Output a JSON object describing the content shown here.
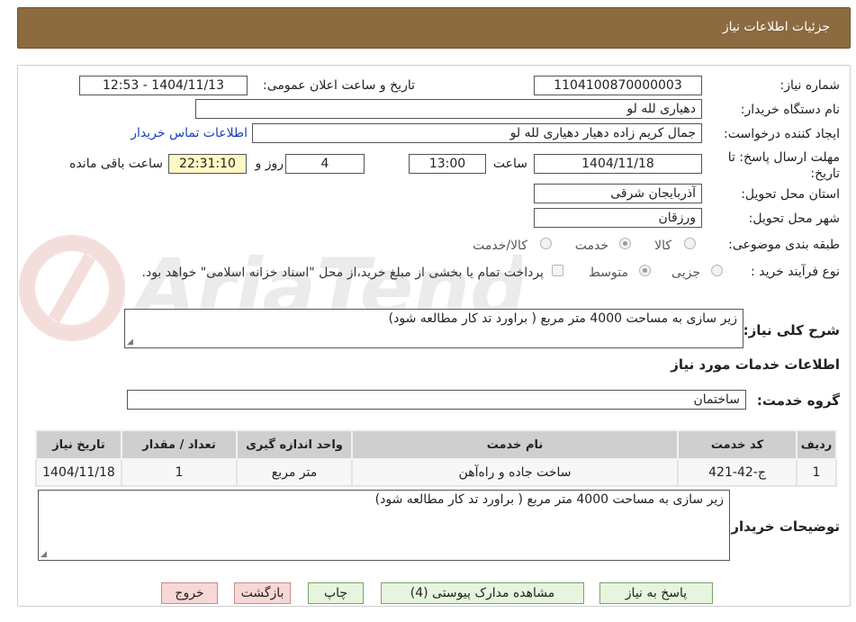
{
  "header": {
    "title": "جزئیات اطلاعات نیاز"
  },
  "form": {
    "need_number_label": "شماره نیاز:",
    "need_number": "1104100870000003",
    "announce_label": "تاریخ و ساعت اعلان عمومی:",
    "announce_value": "1404/11/13 - 12:53",
    "buyer_org_label": "نام دستگاه خریدار:",
    "buyer_org": "دهیاری لله لو",
    "creator_label": "ایجاد کننده درخواست:",
    "creator": "جمال کریم زاده دهیار دهیاری لله لو",
    "contact_link": "اطلاعات تماس خریدار",
    "deadline_label_line1": "مهلت ارسال پاسخ: تا",
    "deadline_label_line2": "تاریخ:",
    "deadline_date": "1404/11/18",
    "time_label": "ساعت",
    "deadline_time": "13:00",
    "days_value": "4",
    "days_label": "روز و",
    "remaining_time": "22:31:10",
    "remaining_label": "ساعت باقی مانده",
    "province_label": "استان محل تحویل:",
    "province": "آذربایجان شرقی",
    "city_label": "شهر محل تحویل:",
    "city": "ورزقان",
    "category_label": "طبقه بندی موضوعی:",
    "category_options": [
      "کالا",
      "خدمت",
      "کالا/خدمت"
    ],
    "category_selected_index": 1,
    "process_label": "نوع فرآیند خرید :",
    "process_options": [
      "جزیی",
      "متوسط"
    ],
    "process_selected_index": 1,
    "payment_note": "پرداخت تمام یا بخشی از مبلغ خرید،از محل \"اسناد خزانه اسلامی\" خواهد بود.",
    "general_desc_label": "شرح کلی نیاز:",
    "general_desc": "زیر سازی به مساحت 4000  متر مربع ( براورد تد کار مطالعه شود)",
    "services_section_title": "اطلاعات خدمات مورد نیاز",
    "service_group_label": "گروه خدمت:",
    "service_group": "ساختمان"
  },
  "table": {
    "headers": [
      "ردیف",
      "کد خدمت",
      "نام خدمت",
      "واحد اندازه گیری",
      "تعداد / مقدار",
      "تاریخ نیاز"
    ],
    "rows": [
      [
        "1",
        "ج-42-421",
        "ساخت جاده و راه‌آهن",
        "متر مربع",
        "1",
        "1404/11/18"
      ]
    ]
  },
  "buyer_notes": {
    "label": "توضیحات خریدار:",
    "text": "زیر سازی به مساحت 4000  متر مربع ( براورد تد کار مطالعه شود)"
  },
  "buttons": {
    "reply": "پاسخ به نیاز",
    "attachments": "مشاهده مدارک پیوستی (4)",
    "print": "چاپ",
    "back": "بازگشت",
    "exit": "خروج"
  },
  "colors": {
    "header_bg": "#8b6b3f",
    "button_green": "#e7f5df",
    "button_red": "#f8d7d7",
    "remaining_bg": "#fff8c4",
    "link": "#1a3fb8"
  }
}
